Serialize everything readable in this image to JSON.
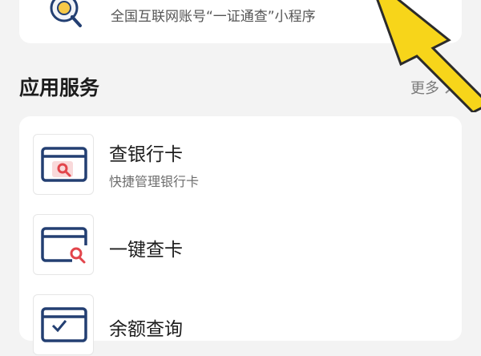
{
  "top_card": {
    "subtitle": "全国互联网账号“一证通查”小程序",
    "icon": "magnifier-badge-icon"
  },
  "section": {
    "title": "应用服务",
    "more_label": "更多"
  },
  "services": [
    {
      "title": "查银行卡",
      "desc": "快捷管理银行卡",
      "icon": "bank-card-search-icon"
    },
    {
      "title": "一键查卡",
      "desc": "",
      "icon": "card-search-icon"
    },
    {
      "title": "余额查询",
      "desc": "",
      "icon": "card-check-icon"
    }
  ],
  "colors": {
    "icon_blue": "#233f72",
    "icon_red": "#e2454b",
    "arrow_yellow": "#f7d51a"
  }
}
